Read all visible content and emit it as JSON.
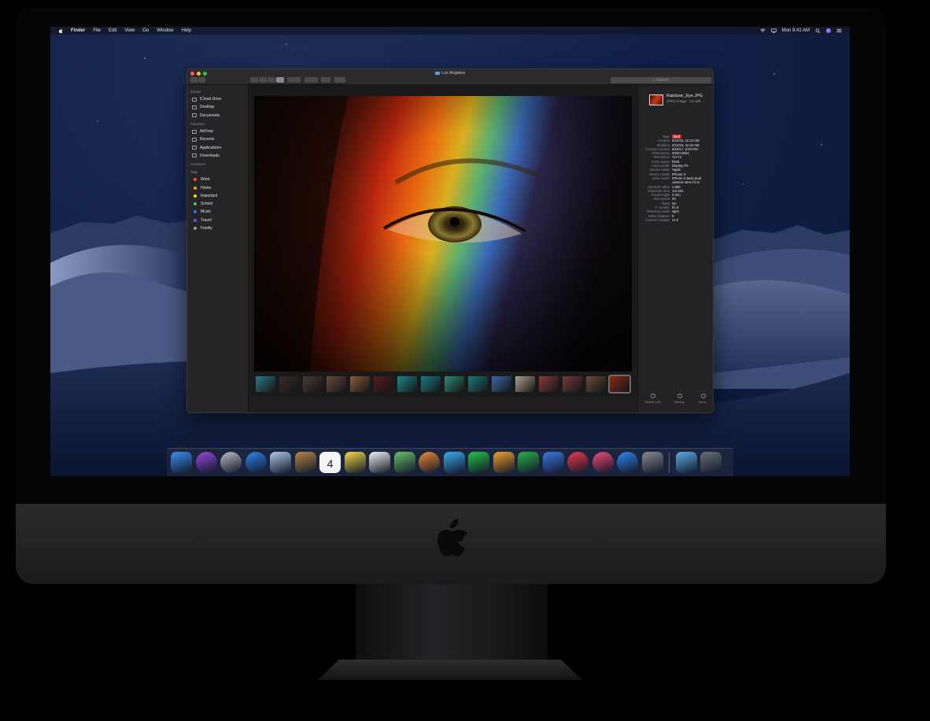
{
  "menubar": {
    "items": [
      "Finder",
      "File",
      "Edit",
      "View",
      "Go",
      "Window",
      "Help"
    ],
    "clock": "Mon 9:41 AM"
  },
  "window": {
    "title": "Los Angeles",
    "search_placeholder": "Search"
  },
  "sidebar": {
    "sections": [
      {
        "header": "iCloud",
        "items": [
          {
            "label": "iCloud Drive",
            "icon": "cloud-icon"
          },
          {
            "label": "Desktop",
            "icon": "desktop-icon"
          },
          {
            "label": "Documents",
            "icon": "document-icon"
          }
        ]
      },
      {
        "header": "Favorites",
        "items": [
          {
            "label": "AirDrop",
            "icon": "airdrop-icon"
          },
          {
            "label": "Recents",
            "icon": "clock-icon"
          },
          {
            "label": "Applications",
            "icon": "applications-icon"
          },
          {
            "label": "Downloads",
            "icon": "download-icon"
          }
        ]
      },
      {
        "header": "Locations",
        "items": []
      },
      {
        "header": "Tags",
        "items": [
          {
            "label": "Work",
            "color": "#ff453a"
          },
          {
            "label": "Home",
            "color": "#ff9f0a"
          },
          {
            "label": "Important",
            "color": "#ffd60a"
          },
          {
            "label": "School",
            "color": "#32d74b"
          },
          {
            "label": "Music",
            "color": "#0a84ff"
          },
          {
            "label": "Travel",
            "color": "#5e5ce6"
          },
          {
            "label": "Family",
            "color": "#98989d"
          }
        ]
      }
    ]
  },
  "inspector": {
    "file_name": "Rainbow_Eye.JPG",
    "file_info": "JPEG image - 3.6 MB",
    "metadata": [
      {
        "key": "Tags",
        "value": "Red"
      },
      {
        "key": "Created",
        "value": "3/12/18, 11:34 AM"
      },
      {
        "key": "Modified",
        "value": "3/12/18, 11:34 AM"
      },
      {
        "key": "Content created",
        "value": "8/23/17, 4:03 PM"
      },
      {
        "key": "Dimensions",
        "value": "4032×3024"
      },
      {
        "key": "Resolution",
        "value": "72×72"
      },
      {
        "key": "Color space",
        "value": "RGB"
      },
      {
        "key": "Color profile",
        "value": "Display P3"
      },
      {
        "key": "Device make",
        "value": "Apple"
      },
      {
        "key": "Device model",
        "value": "iPhone X"
      },
      {
        "key": "Lens model",
        "value": "iPhone X back dual"
      },
      {
        "key": "",
        "value": "camera 4mm f/1.8"
      },
      {
        "key": "Aperture value",
        "value": "1.696"
      },
      {
        "key": "Exposure time",
        "value": "1/2,183"
      },
      {
        "key": "Focal length",
        "value": "4 mm"
      },
      {
        "key": "ISO speed",
        "value": "20"
      },
      {
        "key": "Flash",
        "value": "No"
      },
      {
        "key": "F number",
        "value": "f/1.8"
      },
      {
        "key": "Metering mode",
        "value": "Spot"
      },
      {
        "key": "White balance",
        "value": "0"
      },
      {
        "key": "Content Creator",
        "value": "11.0"
      }
    ],
    "actions": [
      {
        "label": "Rotate Left",
        "icon": "rotate-left-icon"
      },
      {
        "label": "Markup",
        "icon": "markup-icon"
      },
      {
        "label": "More...",
        "icon": "more-icon"
      }
    ]
  },
  "filmstrip": [
    {
      "color": "#2a7a8a"
    },
    {
      "color": "#3a2a2a"
    },
    {
      "color": "#4a3a3a"
    },
    {
      "color": "#6a4a3a"
    },
    {
      "color": "#8a5a3a"
    },
    {
      "color": "#5a1a1a"
    },
    {
      "color": "#1a8a8a"
    },
    {
      "color": "#1a7a8a"
    },
    {
      "color": "#2a8a7a"
    },
    {
      "color": "#1a7a7a"
    },
    {
      "color": "#3a6aaa"
    },
    {
      "color": "#aaa090"
    },
    {
      "color": "#8a3a3a"
    },
    {
      "color": "#7a3a3a"
    },
    {
      "color": "#6a4a3a"
    },
    {
      "color": "#8a2a10"
    }
  ],
  "dock": [
    {
      "name": "finder-icon",
      "color": "#3b8ef0"
    },
    {
      "name": "siri-icon",
      "color": "#9a4ae0"
    },
    {
      "name": "launchpad-icon",
      "color": "#b8bcc4"
    },
    {
      "name": "safari-icon",
      "color": "#2a86f0"
    },
    {
      "name": "mail-icon",
      "color": "#aac8e8"
    },
    {
      "name": "contacts-icon",
      "color": "#b8864a"
    },
    {
      "name": "calendar-icon",
      "color": "#f4f4f4"
    },
    {
      "name": "notes-icon",
      "color": "#f4d94a"
    },
    {
      "name": "reminders-icon",
      "color": "#f0f0f0"
    },
    {
      "name": "maps-icon",
      "color": "#6ac06a"
    },
    {
      "name": "photos-icon",
      "color": "#f08a3a"
    },
    {
      "name": "messages-icon",
      "color": "#3aaaf0"
    },
    {
      "name": "facetime-icon",
      "color": "#2ac04a"
    },
    {
      "name": "pages-icon",
      "color": "#f0a030"
    },
    {
      "name": "numbers-icon",
      "color": "#2ab04a"
    },
    {
      "name": "keynote-icon",
      "color": "#3a7ae0"
    },
    {
      "name": "news-icon",
      "color": "#f03a4a"
    },
    {
      "name": "music-icon",
      "color": "#f04a7a"
    },
    {
      "name": "app-store-icon",
      "color": "#2a8af0"
    },
    {
      "name": "system-preferences-icon",
      "color": "#8a8a90"
    },
    {
      "name": "downloads-folder-icon",
      "color": "#5aaee8"
    },
    {
      "name": "trash-icon",
      "color": "#6a7078"
    }
  ],
  "calendar_day": "4"
}
